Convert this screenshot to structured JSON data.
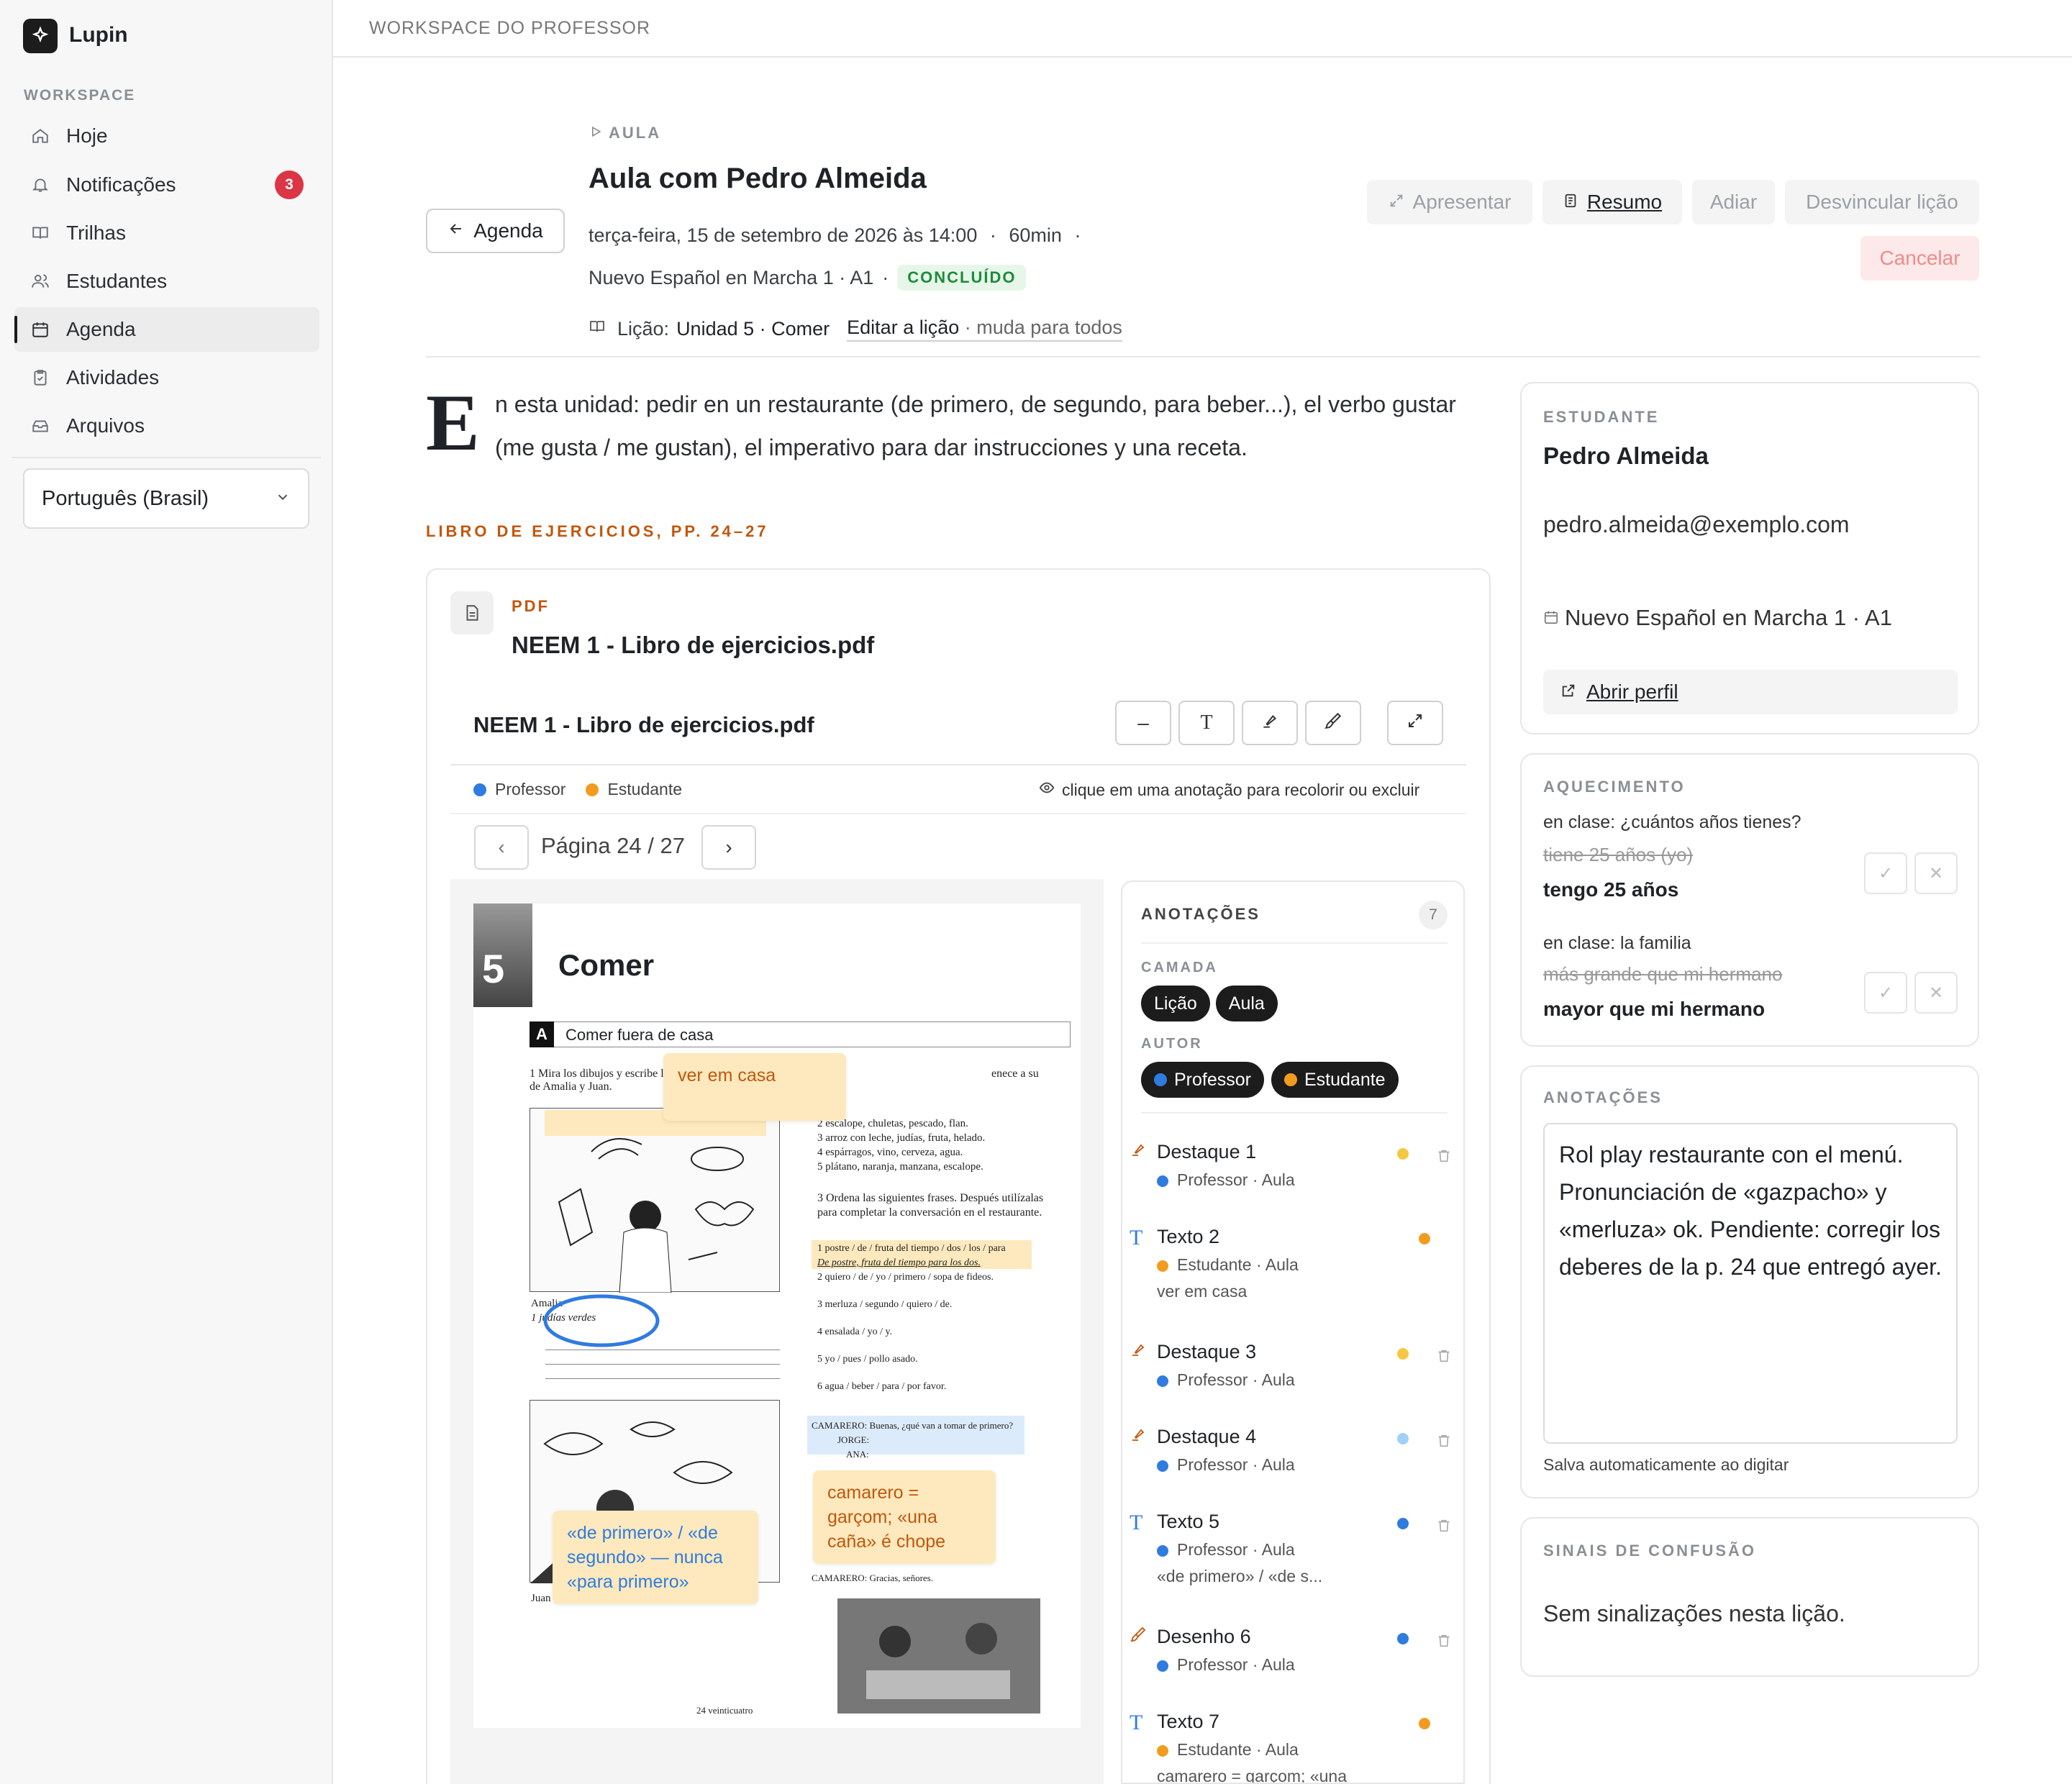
{
  "app": {
    "name": "Lupin"
  },
  "sidebar": {
    "section": "WORKSPACE",
    "items": [
      {
        "label": "Hoje",
        "icon": "home-icon"
      },
      {
        "label": "Notificações",
        "icon": "bell-icon",
        "badge": "3"
      },
      {
        "label": "Trilhas",
        "icon": "book-icon"
      },
      {
        "label": "Estudantes",
        "icon": "users-icon"
      },
      {
        "label": "Agenda",
        "icon": "calendar-icon",
        "active": true
      },
      {
        "label": "Atividades",
        "icon": "clipboard-icon"
      },
      {
        "label": "Arquivos",
        "icon": "archive-icon"
      }
    ],
    "language": "Português (Brasil)"
  },
  "topbar": {
    "title": "WORKSPACE DO PROFESSOR"
  },
  "header": {
    "back_label": "Agenda",
    "kicker": "AULA",
    "title": "Aula com Pedro Almeida",
    "datetime": "terça-feira, 15 de setembro de 2026 às 14:00",
    "duration": "60min",
    "course": "Nuevo Español en Marcha 1 · A1",
    "status": "CONCLUÍDO",
    "lesson_prefix": "Lição:",
    "lesson_name": "Unidad 5 · Comer",
    "edit_lesson": "Editar a lição",
    "edit_lesson_note": "· muda para todos",
    "buttons": {
      "present": "Apresentar",
      "summary": "Resumo",
      "postpone": "Adiar",
      "unlink": "Desvincular lição",
      "cancel": "Cancelar"
    }
  },
  "intro": {
    "dropcap": "E",
    "text": "n esta unidad: pedir en un restaurante (de primero, de segundo, para beber...), el verbo gustar (me gusta / me gustan), el imperativo para dar instrucciones y una receta."
  },
  "material": {
    "kicker": "LIBRO DE EJERCICIOS, PP. 24–27",
    "type": "PDF",
    "file_name": "NEEM 1 - Libro de ejercicios.pdf",
    "viewer_title": "NEEM 1 - Libro de ejercicios.pdf",
    "legend": {
      "teacher": "Professor",
      "student": "Estudante",
      "hint": "clique em uma anotação para recolorir ou excluir"
    },
    "page_label": "Página 24 / 27",
    "page": {
      "unit_number": "5",
      "unit_title": "Comer",
      "section_letter": "A",
      "section_title": "Comer fuera de casa",
      "ex1": "1  Mira los dibujos y escribe las comidas favoritas de Amalia y Juan.",
      "amalia": "Amalia",
      "amalia_answer": "1  judías verdes",
      "list": [
        "2  escalope, chuletas, pescado, flan.",
        "3  arroz con leche, judías, fruta, helado.",
        "4  espárragos, vino, cerveza, agua.",
        "5  plátano, naranja, manzana, escalope."
      ],
      "ex3": "3  Ordena las siguientes frases. Después utilízalas para completar la conversación en el restaurante.",
      "ex3_items": [
        "1  postre / de / fruta del tiempo / dos / los / para",
        "De postre, fruta del tiempo para los dos.",
        "2  quiero / de / yo / primero / sopa de fideos.",
        "3  merluza / segundo / quiero / de.",
        "4  ensalada / yo / y.",
        "5  yo / pues / pollo asado.",
        "6  agua / beber / para / por favor."
      ],
      "dialog": [
        "CAMARERO: Buenas, ¿qué van a tomar de primero?",
        "JORGE:",
        "ANA:"
      ],
      "dialog_end": "CAMARERO:  Gracias, señores.",
      "juan": "Juan",
      "footer": "24 veinticuatro",
      "note_1": "ver em casa",
      "note_2": "camarero = garçom; «una caña» é chope",
      "note_3": "«de primero» / «de segundo» — nunca «para primero»",
      "partial_text": "enece a su"
    }
  },
  "annotations": {
    "title": "ANOTAÇÕES",
    "count": "7",
    "layer_label": "CAMADA",
    "layers": [
      "Lição",
      "Aula"
    ],
    "author_label": "AUTOR",
    "authors": [
      "Professor",
      "Estudante"
    ],
    "items": [
      {
        "title": "Destaque 1",
        "author": "Professor",
        "layer": "Aula",
        "icon": "highlighter-icon",
        "color": "#f5c842"
      },
      {
        "title": "Texto 2",
        "author": "Estudante",
        "layer": "Aula",
        "text": "ver em casa",
        "icon": "text-icon",
        "color": "#f29c1f"
      },
      {
        "title": "Destaque 3",
        "author": "Professor",
        "layer": "Aula",
        "icon": "highlighter-icon",
        "color": "#f5c842"
      },
      {
        "title": "Destaque 4",
        "author": "Professor",
        "layer": "Aula",
        "icon": "highlighter-icon",
        "color": "#9fd0f5"
      },
      {
        "title": "Texto 5",
        "author": "Professor",
        "layer": "Aula",
        "text": "«de primero» / «de s...",
        "icon": "text-icon",
        "color": "#2f7be0"
      },
      {
        "title": "Desenho 6",
        "author": "Professor",
        "layer": "Aula",
        "icon": "brush-icon",
        "color": "#2f7be0"
      },
      {
        "title": "Texto 7",
        "author": "Estudante",
        "layer": "Aula",
        "text": "camarero = garçom; «una",
        "icon": "text-icon",
        "color": "#f29c1f"
      }
    ]
  },
  "student": {
    "kicker": "ESTUDANTE",
    "name": "Pedro Almeida",
    "email": "pedro.almeida@exemplo.com",
    "course": "Nuevo Español en Marcha 1 · A1",
    "open_profile": "Abrir perfil"
  },
  "warmup": {
    "kicker": "AQUECIMENTO",
    "items": [
      {
        "prompt": "en clase: ¿cuántos años tienes?",
        "wrong": "tiene 25 años (yo)",
        "right": "tengo 25 años"
      },
      {
        "prompt": "en clase: la familia",
        "wrong": "más grande que mi hermano",
        "right": "mayor que mi hermano"
      }
    ]
  },
  "notes": {
    "kicker": "ANOTAÇÕES",
    "text": "Rol play restaurante con el menú. Pronunciación de «gazpacho» y «merluza» ok. Pendiente: corregir los deberes de la p. 24 que entregó ayer.",
    "autosave": "Salva automaticamente ao digitar"
  },
  "confusion": {
    "kicker": "SINAIS DE CONFUSÃO",
    "text": "Sem sinalizações nesta lição."
  },
  "colors": {
    "teacher": "#2f7be0",
    "student": "#f29c1f",
    "accent_orange": "#c2560c",
    "status_green": "#1f8a3a"
  }
}
